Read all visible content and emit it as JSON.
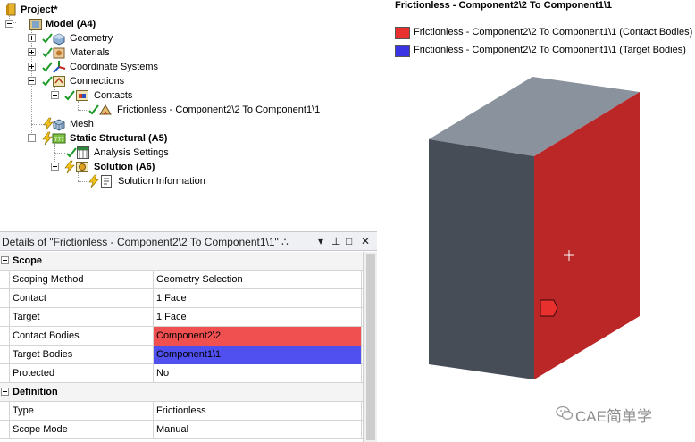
{
  "tree": {
    "items": [
      {
        "label": "Project*",
        "icon": "project-icon",
        "bold": true
      },
      {
        "label": "Model (A4)",
        "icon": "model-icon",
        "bold": true
      },
      {
        "label": "Geometry",
        "icon": "geometry-icon"
      },
      {
        "label": "Materials",
        "icon": "materials-icon"
      },
      {
        "label": "Coordinate Systems",
        "icon": "coordinate-systems-icon"
      },
      {
        "label": "Connections",
        "icon": "connections-icon"
      },
      {
        "label": "Contacts",
        "icon": "contacts-icon"
      },
      {
        "label": "Frictionless - Component2\\2 To Component1\\1",
        "icon": "contact-region-icon"
      },
      {
        "label": "Mesh",
        "icon": "mesh-icon"
      },
      {
        "label": "Static Structural (A5)",
        "icon": "static-structural-icon",
        "bold": true
      },
      {
        "label": "Analysis Settings",
        "icon": "analysis-settings-icon"
      },
      {
        "label": "Solution (A6)",
        "icon": "solution-icon",
        "bold": true
      },
      {
        "label": "Solution Information",
        "icon": "solution-information-icon"
      }
    ]
  },
  "details": {
    "title": "Details of \"Frictionless - Component2\\2 To Component1\\1\" ∴",
    "controls": {
      "dropdown": "▾",
      "pin": "⊥",
      "maximize": "□",
      "close": "✕"
    },
    "groups": [
      {
        "label": "Scope",
        "rows": [
          {
            "key": "Scoping Method",
            "value": "Geometry Selection"
          },
          {
            "key": "Contact",
            "value": "1 Face"
          },
          {
            "key": "Target",
            "value": "1 Face"
          },
          {
            "key": "Contact Bodies",
            "value": "Component2\\2",
            "highlight": "#f15050"
          },
          {
            "key": "Target Bodies",
            "value": "Component1\\1",
            "highlight": "#5050f0"
          },
          {
            "key": "Protected",
            "value": "No"
          }
        ]
      },
      {
        "label": "Definition",
        "rows": [
          {
            "key": "Type",
            "value": "Frictionless"
          },
          {
            "key": "Scope Mode",
            "value": "Manual"
          }
        ]
      }
    ]
  },
  "graphics": {
    "title": "Frictionless - Component2\\2 To Component1\\1",
    "legend": [
      {
        "label": "Frictionless - Component2\\2 To Component1\\1 (Contact Bodies)",
        "color": "#e8302e"
      },
      {
        "label": "Frictionless - Component2\\2 To Component1\\1 (Target Bodies)",
        "color": "#3a34e4"
      }
    ],
    "colors": {
      "top_face": "#8a929d",
      "front_face": "#474d57",
      "side_face": "#bb2626"
    }
  },
  "watermark": {
    "text": "CAE简单学",
    "icon": "wechat-icon"
  }
}
